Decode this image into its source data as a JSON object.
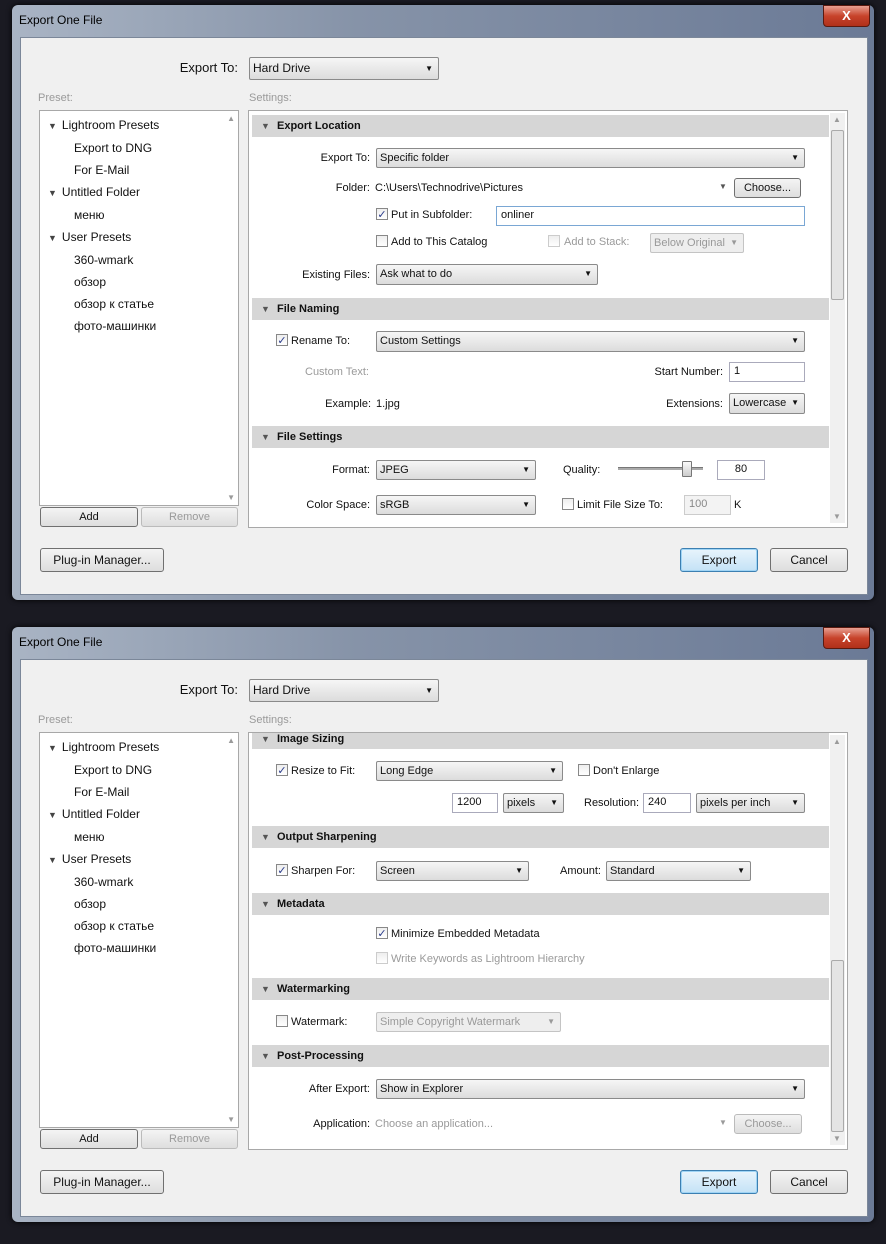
{
  "dialogs": [
    {
      "title": "Export One File",
      "close": "X",
      "export_to_label": "Export To:",
      "export_to_value": "Hard Drive",
      "preset_label": "Preset:",
      "settings_label": "Settings:",
      "presets": [
        {
          "label": "Lightroom Presets",
          "folder": true
        },
        {
          "label": "Export to DNG"
        },
        {
          "label": "For E-Mail"
        },
        {
          "label": "Untitled Folder",
          "folder": true
        },
        {
          "label": "меню"
        },
        {
          "label": "User Presets",
          "folder": true
        },
        {
          "label": "360-wmark"
        },
        {
          "label": "обзор"
        },
        {
          "label": "обзор к статье"
        },
        {
          "label": "фото-машинки"
        }
      ],
      "add": "Add",
      "remove": "Remove",
      "plugin_manager": "Plug-in Manager...",
      "export": "Export",
      "cancel": "Cancel",
      "sections": {
        "export_location": {
          "title": "Export Location",
          "export_to_label": "Export To:",
          "export_to_value": "Specific folder",
          "folder_label": "Folder:",
          "folder_path": "C:\\Users\\Technodrive\\Pictures",
          "choose": "Choose...",
          "subfolder_label": "Put in Subfolder:",
          "subfolder_checked": true,
          "subfolder_value": "onliner",
          "add_catalog_label": "Add to This Catalog",
          "add_catalog_checked": false,
          "add_stack_label": "Add to Stack:",
          "add_stack_value": "Below Original",
          "existing_label": "Existing Files:",
          "existing_value": "Ask what to do"
        },
        "file_naming": {
          "title": "File Naming",
          "rename_label": "Rename To:",
          "rename_checked": true,
          "rename_value": "Custom Settings",
          "custom_text_label": "Custom Text:",
          "start_number_label": "Start Number:",
          "start_number": "1",
          "example_label": "Example:",
          "example_value": "1.jpg",
          "extensions_label": "Extensions:",
          "extensions_value": "Lowercase"
        },
        "file_settings": {
          "title": "File Settings",
          "format_label": "Format:",
          "format_value": "JPEG",
          "quality_label": "Quality:",
          "quality_value": "80",
          "quality_percent": 80,
          "color_space_label": "Color Space:",
          "color_space_value": "sRGB",
          "limit_label": "Limit File Size To:",
          "limit_checked": false,
          "limit_value": "100",
          "limit_unit": "K"
        }
      }
    },
    {
      "title": "Export One File",
      "close": "X",
      "export_to_label": "Export To:",
      "export_to_value": "Hard Drive",
      "preset_label": "Preset:",
      "settings_label": "Settings:",
      "presets": [
        {
          "label": "Lightroom Presets",
          "folder": true
        },
        {
          "label": "Export to DNG"
        },
        {
          "label": "For E-Mail"
        },
        {
          "label": "Untitled Folder",
          "folder": true
        },
        {
          "label": "меню"
        },
        {
          "label": "User Presets",
          "folder": true
        },
        {
          "label": "360-wmark"
        },
        {
          "label": "обзор"
        },
        {
          "label": "обзор к статье"
        },
        {
          "label": "фото-машинки"
        }
      ],
      "add": "Add",
      "remove": "Remove",
      "plugin_manager": "Plug-in Manager...",
      "export": "Export",
      "cancel": "Cancel",
      "sections": {
        "image_sizing": {
          "title": "Image Sizing",
          "resize_label": "Resize to Fit:",
          "resize_checked": true,
          "resize_value": "Long Edge",
          "dont_enlarge_label": "Don't Enlarge",
          "dont_enlarge_checked": false,
          "size_value": "1200",
          "size_unit": "pixels",
          "resolution_label": "Resolution:",
          "resolution_value": "240",
          "resolution_unit": "pixels per inch"
        },
        "output_sharpening": {
          "title": "Output Sharpening",
          "sharpen_label": "Sharpen For:",
          "sharpen_checked": true,
          "sharpen_value": "Screen",
          "amount_label": "Amount:",
          "amount_value": "Standard"
        },
        "metadata": {
          "title": "Metadata",
          "minimize_label": "Minimize Embedded Metadata",
          "minimize_checked": true,
          "keywords_label": "Write Keywords as Lightroom Hierarchy",
          "keywords_checked": false
        },
        "watermarking": {
          "title": "Watermarking",
          "watermark_label": "Watermark:",
          "watermark_checked": false,
          "watermark_value": "Simple Copyright Watermark"
        },
        "post_processing": {
          "title": "Post-Processing",
          "after_export_label": "After Export:",
          "after_export_value": "Show in Explorer",
          "application_label": "Application:",
          "application_placeholder": "Choose an application...",
          "choose": "Choose..."
        }
      }
    }
  ]
}
